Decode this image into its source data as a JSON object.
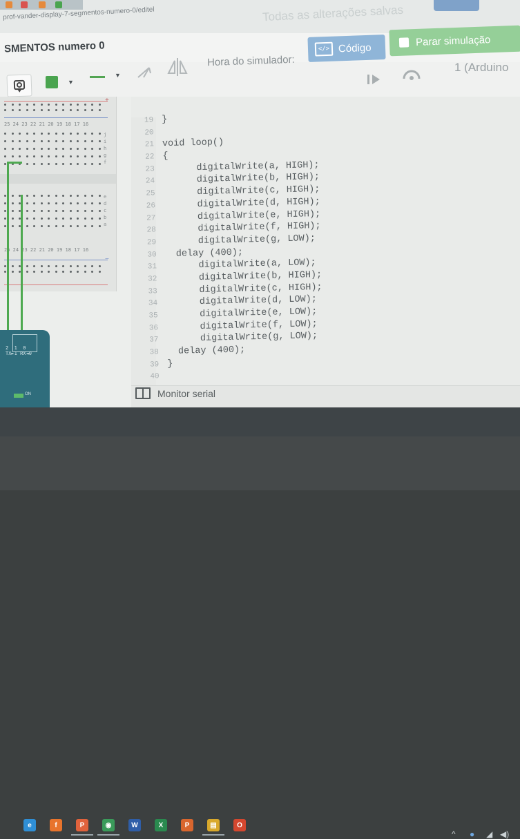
{
  "browser": {
    "url_text": "prof-vander-display-7-segmentos-numero-0/editel",
    "save_status": "Todas as alterações salvas"
  },
  "header": {
    "project_title": "SMENTOS numero 0",
    "code_button_label": "Código",
    "code_icon_glyph": "</>",
    "simulation_button_label": "Parar simulação"
  },
  "toolbar": {
    "sim_time_label": "Hora do simulador:",
    "board_label": "1 (Arduino"
  },
  "breadboard": {
    "column_numbers": "25 24 23 22 21 20 19 18 17 16",
    "row_letters_top": [
      "j",
      "i",
      "h",
      "g",
      "f"
    ],
    "row_letters_bottom": [
      "e",
      "d",
      "c",
      "b",
      "a"
    ],
    "rail_plus": "+",
    "rail_minus": "−"
  },
  "arduino": {
    "pin_labels": "2  1  0\nTX►1 RX◄0",
    "on_label": "ON"
  },
  "editor": {
    "lines": [
      {
        "num": "19",
        "text": "}"
      },
      {
        "num": "20",
        "text": ""
      },
      {
        "num": "21",
        "text": "void loop()"
      },
      {
        "num": "22",
        "text": "{"
      },
      {
        "num": "23",
        "text": "      digitalWrite(a, HIGH);"
      },
      {
        "num": "24",
        "text": "      digitalWrite(b, HIGH);"
      },
      {
        "num": "25",
        "text": "      digitalWrite(c, HIGH);"
      },
      {
        "num": "26",
        "text": "      digitalWrite(d, HIGH);"
      },
      {
        "num": "27",
        "text": "      digitalWrite(e, HIGH);"
      },
      {
        "num": "28",
        "text": "      digitalWrite(f, HIGH);"
      },
      {
        "num": "29",
        "text": "      digitalWrite(g, LOW);"
      },
      {
        "num": "30",
        "text": "  delay (400);"
      },
      {
        "num": "31",
        "text": "      digitalWrite(a, LOW);"
      },
      {
        "num": "32",
        "text": "      digitalWrite(b, HIGH);"
      },
      {
        "num": "33",
        "text": "      digitalWrite(c, HIGH);"
      },
      {
        "num": "34",
        "text": "      digitalWrite(d, LOW);"
      },
      {
        "num": "35",
        "text": "      digitalWrite(e, LOW);"
      },
      {
        "num": "36",
        "text": "      digitalWrite(f, LOW);"
      },
      {
        "num": "37",
        "text": "      digitalWrite(g, LOW);"
      },
      {
        "num": "38",
        "text": "  delay (400);"
      },
      {
        "num": "39",
        "text": "}"
      },
      {
        "num": "40",
        "text": ""
      }
    ]
  },
  "serial_monitor": {
    "label": "Monitor serial"
  },
  "taskbar": {
    "apps": [
      {
        "icon": "edge-icon",
        "color": "#2f8fd6"
      },
      {
        "icon": "firefox-icon",
        "color": "#e8742c"
      },
      {
        "icon": "paint-icon",
        "color": "#e0623c"
      },
      {
        "icon": "chrome-icon",
        "color": "#3a9b5a"
      },
      {
        "icon": "word-icon",
        "color": "#2f5ea8"
      },
      {
        "icon": "excel-icon",
        "color": "#2a8a4f"
      },
      {
        "icon": "powerpoint-icon",
        "color": "#d9662e"
      },
      {
        "icon": "explorer-icon",
        "color": "#d9a92c"
      },
      {
        "icon": "office-icon",
        "color": "#d4472f"
      }
    ]
  },
  "colors": {
    "code_button": "#8fb5d8",
    "simulation_button": "#95cf98",
    "wire_green": "#4ea950",
    "arduino_teal": "#2f6d7c"
  }
}
